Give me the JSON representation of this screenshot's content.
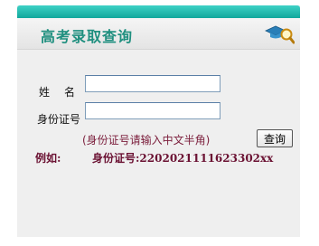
{
  "header": {
    "title": "高考录取查询",
    "icon": "graduation-cap-magnifier-icon"
  },
  "form": {
    "name_label": "姓名",
    "name_value": "",
    "id_label": "身份证号",
    "id_value": "",
    "hint": "(身份证号请输入中文半角)",
    "query_button": "查询"
  },
  "example": {
    "label": "例如:",
    "value": "身份证号:2202021111623302xx"
  },
  "colors": {
    "top_bar": "#11a79b",
    "title": "#1f8f7f",
    "hint_text": "#7b1d3b",
    "panel_bg": "#efefef"
  }
}
